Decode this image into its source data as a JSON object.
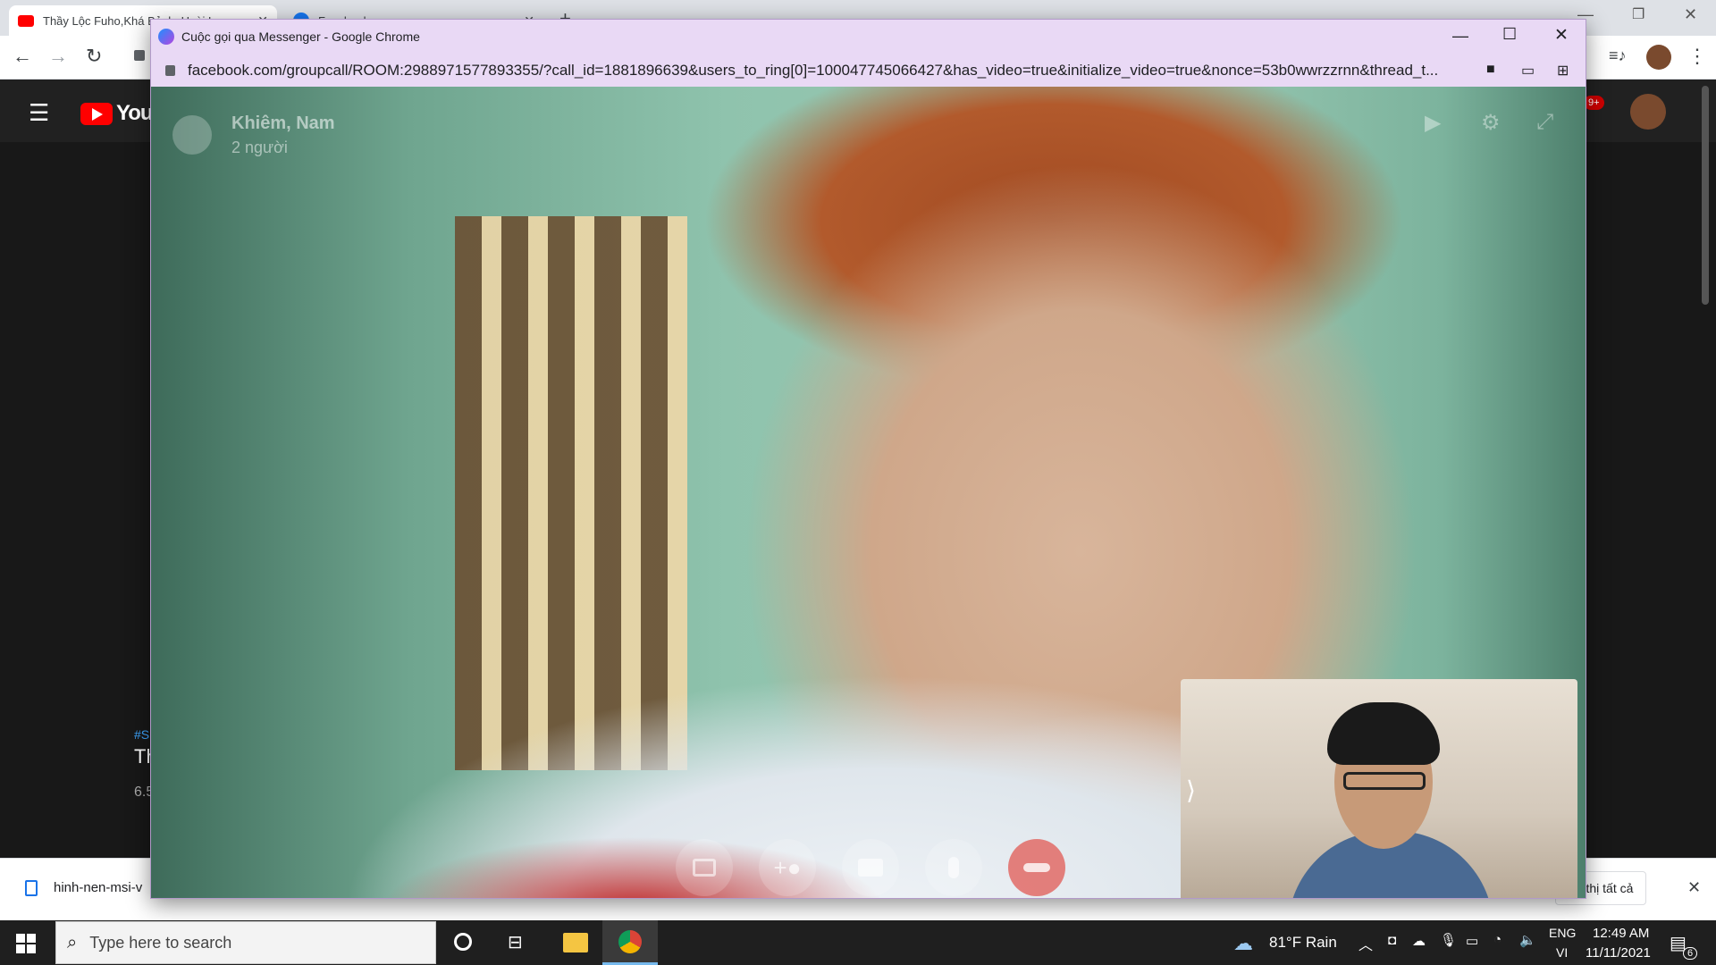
{
  "background_chrome": {
    "tabs": [
      {
        "title": "Thầy Lộc Fuho,Khá Bảnh, Hoài L...",
        "active": true
      },
      {
        "title": "Facebook",
        "active": false
      }
    ],
    "youtube_logo_text": "YouTube",
    "notification_count": "9+",
    "video_tag": "#S",
    "video_title_fragment": "Th",
    "video_views_fragment": "6.5"
  },
  "download_bar": {
    "file_name": "hinh-nen-msi-v",
    "show_all_label": "ển thị tất cả"
  },
  "popup": {
    "window_title": "Cuộc gọi qua Messenger - Google Chrome",
    "url": "facebook.com/groupcall/ROOM:2988971577893355/?call_id=1881896639&users_to_ring[0]=100047745066427&has_video=true&initialize_video=true&nonce=53b0wwrzzrnn&thread_t..."
  },
  "call": {
    "participants": "Khiêm, Nam",
    "count_label": "2 người"
  },
  "taskbar": {
    "search_placeholder": "Type here to search",
    "weather": "81°F  Rain",
    "lang_top": "ENG",
    "lang_bottom": "VI",
    "time": "12:49 AM",
    "date": "11/11/2021",
    "notification_badge": "6"
  },
  "colors": {
    "end_call": "#e0443c",
    "youtube_red": "#ff0000",
    "popup_frame": "#e9d9f5"
  }
}
